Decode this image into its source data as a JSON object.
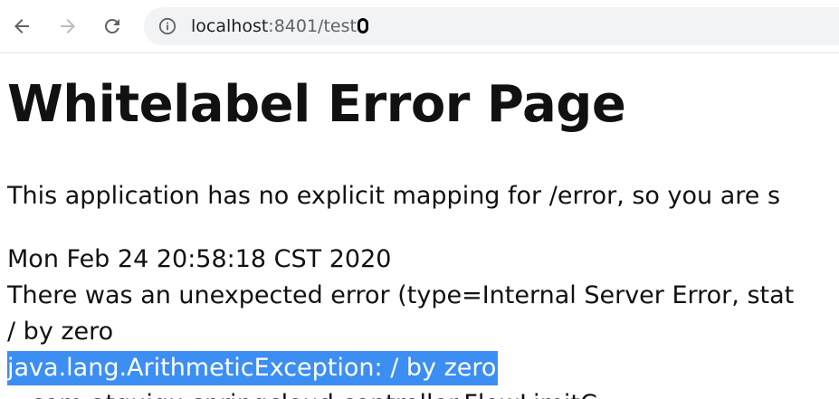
{
  "browser": {
    "url_host": "localhost",
    "url_rest": ":8401/test",
    "back_icon": "arrow-left-icon",
    "forward_icon": "arrow-right-icon",
    "reload_icon": "reload-icon",
    "info_icon": "info-icon"
  },
  "page": {
    "title": "Whitelabel Error Page",
    "explanation": "This application has no explicit mapping for /error, so you are s",
    "timestamp": "Mon Feb 24 20:58:18 CST 2020",
    "error_summary": "There was an unexpected error (type=Internal Server Error, stat",
    "error_message": "/ by zero",
    "exception": "java.lang.ArithmeticException: / by zero",
    "partial_next_line": "...com.atguigu.springcloud.controller.FlowLimitC"
  },
  "colors": {
    "selection": "#3c8ef3",
    "text": "#111111"
  }
}
